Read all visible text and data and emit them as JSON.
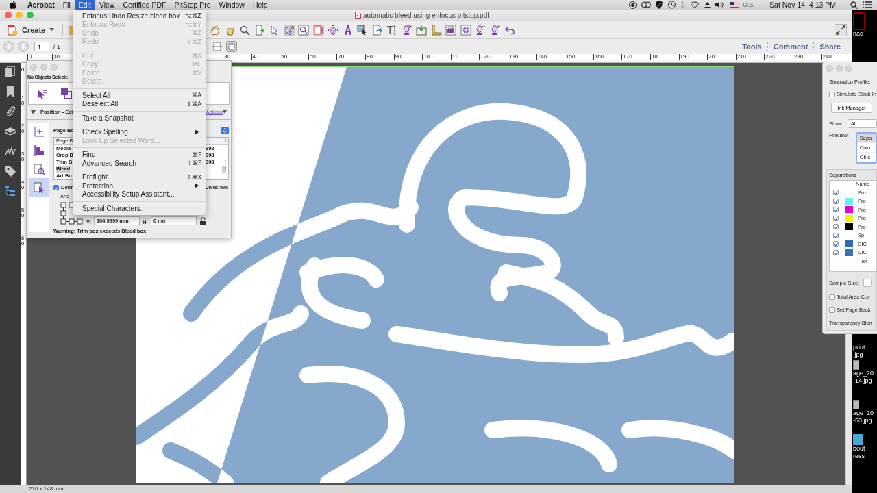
{
  "menu_bar": {
    "items": [
      {
        "label": "Acrobat",
        "selected": false,
        "kind": "app"
      },
      {
        "label": "Fil",
        "selected": false,
        "kind": "menu"
      },
      {
        "label": "Edit",
        "selected": true,
        "kind": "menu"
      },
      {
        "label": "View",
        "selected": false,
        "kind": "menu"
      },
      {
        "label": "Certified PDF",
        "selected": false,
        "kind": "menu"
      },
      {
        "label": "PitStop Pro",
        "selected": false,
        "kind": "menu"
      },
      {
        "label": "Window",
        "selected": false,
        "kind": "menu"
      },
      {
        "label": "Help",
        "selected": false,
        "kind": "menu"
      }
    ],
    "input_source": "U.S.",
    "clock": "Sat Nov 14  4 13 PM"
  },
  "window": {
    "title": "automatic bleed using enfocus pitstop.pdf",
    "create_button": "Create",
    "page_field": "1",
    "page_total": "/ 1",
    "panel_links": [
      "Tools",
      "Comment",
      "Share"
    ],
    "ruler": {
      "left_labels": [
        "0",
        "30"
      ],
      "labels": [
        "30",
        "40",
        "50",
        "60",
        "70",
        "80",
        "90",
        "100",
        "110",
        "120",
        "130",
        "140",
        "150",
        "160",
        "170",
        "180",
        "190",
        "200",
        "210",
        "220",
        "230",
        "240"
      ]
    },
    "vertical_ruler": [
      "0",
      "10",
      "20",
      "30",
      "40",
      "50",
      "60"
    ],
    "status_bar": "210 x 148 mm"
  },
  "edit_menu": {
    "items": [
      {
        "kind": "item",
        "label": "Enfocus Undo Resize bleed box",
        "shortcut": "⌥⌘Z",
        "disabled": false
      },
      {
        "kind": "item",
        "label": "Enfocus Redo",
        "shortcut": "⌥⌘Y",
        "disabled": true
      },
      {
        "kind": "item",
        "label": "Undo",
        "shortcut": "⌘Z",
        "disabled": true
      },
      {
        "kind": "item",
        "label": "Redo",
        "shortcut": "⇧⌘Z",
        "disabled": true
      },
      {
        "kind": "separator"
      },
      {
        "kind": "item",
        "label": "Cut",
        "shortcut": "⌘X",
        "disabled": true
      },
      {
        "kind": "item",
        "label": "Copy",
        "shortcut": "⌘C",
        "disabled": true
      },
      {
        "kind": "item",
        "label": "Paste",
        "shortcut": "⌘V",
        "disabled": true
      },
      {
        "kind": "item",
        "label": "Delete",
        "disabled": true
      },
      {
        "kind": "separator"
      },
      {
        "kind": "item",
        "label": "Select All",
        "shortcut": "⌘A",
        "disabled": false
      },
      {
        "kind": "item",
        "label": "Deselect All",
        "shortcut": "⇧⌘A",
        "disabled": false
      },
      {
        "kind": "separator"
      },
      {
        "kind": "item",
        "label": "Take a Snapshot",
        "disabled": false
      },
      {
        "kind": "separator"
      },
      {
        "kind": "item",
        "label": "Check Spelling",
        "disabled": false,
        "submenu": true
      },
      {
        "kind": "item",
        "label": "Look Up Selected Word...",
        "disabled": true
      },
      {
        "kind": "separator"
      },
      {
        "kind": "item",
        "label": "Find",
        "shortcut": "⌘F",
        "disabled": false
      },
      {
        "kind": "item",
        "label": "Advanced Search",
        "shortcut": "⇧⌘F",
        "disabled": false
      },
      {
        "kind": "separator"
      },
      {
        "kind": "item",
        "label": "Preflight...",
        "shortcut": "⇧⌘X",
        "disabled": false
      },
      {
        "kind": "item",
        "label": "Protection",
        "disabled": false,
        "submenu": true
      },
      {
        "kind": "item",
        "label": "Accessibility Setup Assistant...",
        "disabled": false
      },
      {
        "kind": "separator"
      },
      {
        "kind": "item",
        "label": "Special Characters...",
        "disabled": false
      }
    ]
  },
  "inspector": {
    "title": "No Objects Selecte",
    "section": "Position - Edi",
    "actions_link": "Actions",
    "tool_tabs": [
      {
        "selected": false
      },
      {
        "selected": false
      },
      {
        "selected": false
      },
      {
        "selected": true
      }
    ],
    "page_box_label": "Page Bo",
    "table": {
      "header": "Page B",
      "header_flag": "!",
      "rows": [
        {
          "name": "Media",
          "value": "998",
          "selected": false
        },
        {
          "name": "Crop B",
          "value": "998",
          "selected": false
        },
        {
          "name": "Trim B",
          "value": "998",
          "flag": "!",
          "selected": false
        },
        {
          "name": "Bleed",
          "flag": "!",
          "selected": true
        },
        {
          "name": "Art Bo",
          "selected": false
        }
      ]
    },
    "define": {
      "label": "Defin",
      "checked": true
    },
    "units": "Units: mm",
    "anchor_label": "Anc",
    "fields": [
      {
        "label": "Y:",
        "value": "104.9999 mm"
      },
      {
        "label": "H:",
        "value": "0 mm"
      }
    ],
    "warning": "Warning: Trim box exceeds Bleed box"
  },
  "separations_panel": {
    "simulation_label": "Simulation Profile:",
    "simulate_black": {
      "label": "Simulate Black In",
      "checked": false
    },
    "ink_button": "Ink Manager",
    "show_label": "Show:",
    "show_value": "All",
    "preview_label": "Preview:",
    "preview_options": [
      {
        "label": "Sepa",
        "selected": true
      },
      {
        "label": "Colo",
        "selected": false
      },
      {
        "label": "Obje",
        "selected": false
      }
    ],
    "group_title": "Separations",
    "column": "Name",
    "rows": [
      {
        "kind": "ink",
        "name": "Pro",
        "checked": true
      },
      {
        "kind": "ink",
        "name": "Pro",
        "checked": true,
        "color": "#5ef4f6"
      },
      {
        "kind": "ink",
        "name": "Pro",
        "checked": true,
        "color": "#e600e0"
      },
      {
        "kind": "ink",
        "name": "Pro",
        "checked": true,
        "color": "#f4f400"
      },
      {
        "kind": "ink",
        "name": "Pro",
        "checked": true,
        "color": "#000000"
      },
      {
        "kind": "ink",
        "name": "Sp",
        "checked": true
      },
      {
        "kind": "ink",
        "name": "DIC",
        "checked": true,
        "color": "#2a6fb3"
      },
      {
        "kind": "ink",
        "name": "DIC",
        "checked": true,
        "color": "#3a70b5"
      },
      {
        "kind": "total",
        "name": "Tot"
      }
    ],
    "sample_size_label": "Sample Size:",
    "options": [
      {
        "label": "Total Area Cov",
        "checked": false
      },
      {
        "label": "Set Page Back",
        "checked": false
      }
    ],
    "transparency_label": "Transparency Blen"
  },
  "desktop": {
    "files": [
      {
        "lines": [
          "nac"
        ]
      },
      {
        "lines": [
          "print",
          ".jpg"
        ]
      },
      {
        "lines": [
          "age_20",
          "-14.jpg"
        ]
      },
      {
        "lines": [
          "age_20",
          "-53.jpg"
        ]
      },
      {
        "lines": [
          "bout",
          "ress"
        ]
      }
    ]
  }
}
